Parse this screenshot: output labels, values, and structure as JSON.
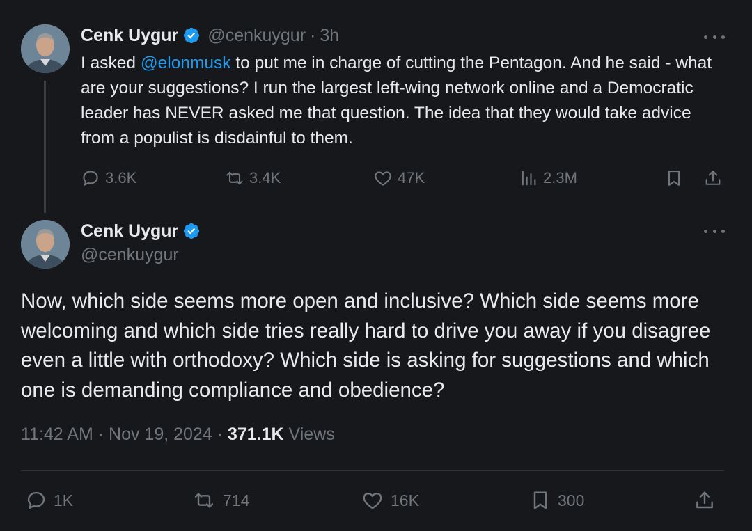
{
  "tweet1": {
    "display_name": "Cenk Uygur",
    "handle": "@cenkuygur",
    "separator": "·",
    "time": "3h",
    "text_before_mention": "I asked ",
    "mention": "@elonmusk",
    "text_after_mention": " to put me in charge of cutting the Pentagon. And he said - what are your suggestions? I run the largest left-wing network online and a Democratic leader has NEVER asked me that question. The idea that they would take advice from a populist is disdainful to them.",
    "stats": {
      "replies": "3.6K",
      "reposts": "3.4K",
      "likes": "47K",
      "views": "2.3M"
    }
  },
  "tweet2": {
    "display_name": "Cenk Uygur",
    "handle": "@cenkuygur",
    "text": "Now, which side seems more open and inclusive? Which side seems more welcoming and which side tries really hard to drive you away if you disagree even a little with orthodoxy? Which side is asking for suggestions and which one is demanding compliance and obedience?",
    "timestamp": "11:42 AM",
    "date": "Nov 19, 2024",
    "separator": "·",
    "views_count": "371.1K",
    "views_label": "Views",
    "stats": {
      "replies": "1K",
      "reposts": "714",
      "likes": "16K",
      "bookmarks": "300"
    }
  },
  "colors": {
    "background": "#16181c",
    "text": "#e7e9ea",
    "secondary": "#71767b",
    "link": "#1d9bf0",
    "verified": "#1d9bf0",
    "divider": "#2f3336"
  },
  "icons": {
    "verified": "verified-badge-icon",
    "more": "more-options-icon",
    "reply": "reply-icon",
    "repost": "repost-icon",
    "like": "like-icon",
    "views": "views-icon",
    "bookmark": "bookmark-icon",
    "share": "share-icon"
  }
}
